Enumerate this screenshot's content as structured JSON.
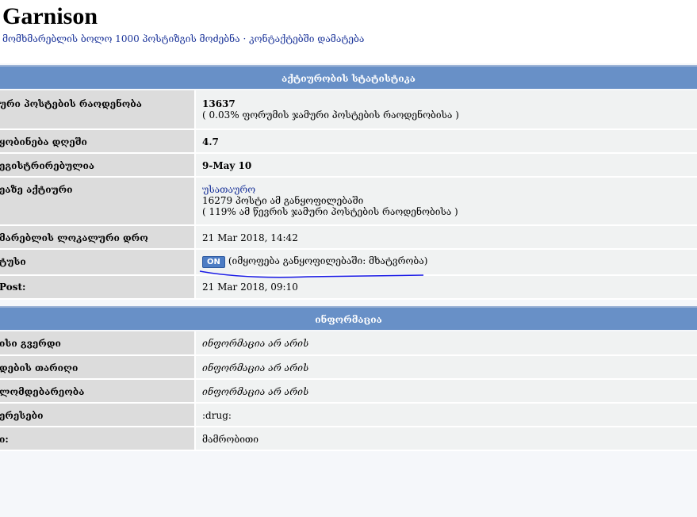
{
  "header": {
    "title": "Garnison",
    "subtitle_links": [
      "მომხმარებლის ბოლო 1000 პოსტიზგის მოძებნა",
      "კონტაქტებში დამატება"
    ],
    "separator": "·"
  },
  "stats": {
    "section_title": "აქტიურობის სტატისტიკა",
    "rows": [
      {
        "label": "ური პოსტების რაოდენობა",
        "value": "13637",
        "note": "( 0.03% ფორუმის ჯამური პოსტების რაოდენობისა )"
      },
      {
        "label": "ყობინება დღეში",
        "value": "4.7"
      },
      {
        "label": "ეგისტრირებულია",
        "value": "9-May 10"
      },
      {
        "label": "ეაზე აქტიური",
        "value": "უსათაურო",
        "line2": "16279 პოსტი ამ განყოფილებაში",
        "line3": "( 119% ამ წევრის ჯამური პოსტების რაოდენობისა )"
      },
      {
        "label": "მარებლის ლოკალური დრო",
        "value": "21 Mar 2018, 14:42"
      },
      {
        "label": "ტუსი",
        "badge": "ON",
        "value": "(იმყოფება განყოფილებაში: მხატვრობა)"
      },
      {
        "label": "Post:",
        "value": "21 Mar 2018, 09:10"
      }
    ]
  },
  "info": {
    "section_title": "ინფორმაცია",
    "rows": [
      {
        "label": "ისი გვერდი",
        "value": "ინფორმაცია არ არის"
      },
      {
        "label": "დების თარიღი",
        "value": "ინფორმაცია არ არის"
      },
      {
        "label": "ლომდებარეობა",
        "value": "ინფორმაცია არ არის"
      },
      {
        "label": "ერესები",
        "value": ":drug:"
      },
      {
        "label": "ი:",
        "value": "მამრობითი"
      }
    ]
  },
  "colors": {
    "section_bar": "#6890c7",
    "label_bg": "#dcdcdc",
    "value_bg": "#f0f2f2",
    "link": "#1a3399",
    "badge": "#4c7cc4"
  }
}
